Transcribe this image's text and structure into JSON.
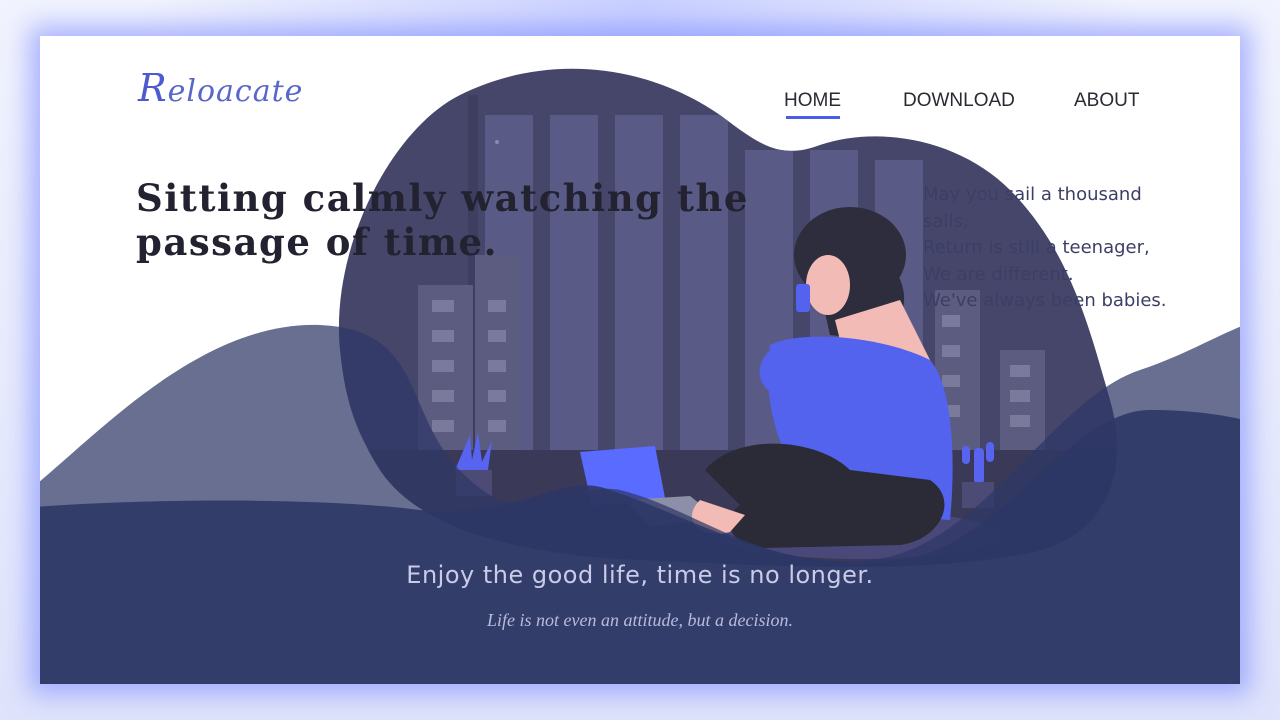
{
  "brand": {
    "logo_initial": "R",
    "logo_rest": "eloacate"
  },
  "nav": {
    "items": [
      {
        "label": "HOME",
        "active": true
      },
      {
        "label": "DOWNLOAD"
      },
      {
        "label": "ABOUT"
      }
    ]
  },
  "hero": {
    "headline_line1": "Sitting calmly watching the",
    "headline_line2": "passage of time.",
    "poem": [
      "May you sail a thousand",
      "sails,",
      "Return is still a teenager,",
      "We are different.",
      "We've always been babies."
    ],
    "tagline": "Enjoy the good life, time is no longer.",
    "subtagline": "Life is not even an attitude, but a decision."
  },
  "colors": {
    "accent": "#4b5ce6",
    "wave": "#2e3766",
    "scene_bg": "#45456a",
    "text_dark": "#222230"
  },
  "icons": [
    "plant-icon",
    "cactus-icon",
    "laptop-icon",
    "phone-icon"
  ]
}
